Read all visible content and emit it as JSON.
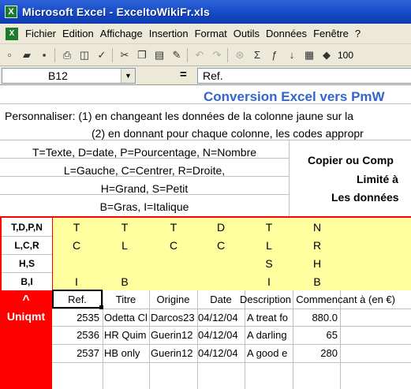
{
  "window": {
    "title": "Microsoft Excel - ExceltoWikiFr.xls",
    "app_icon": "X"
  },
  "menu": [
    "Fichier",
    "Edition",
    "Affichage",
    "Insertion",
    "Format",
    "Outils",
    "Données",
    "Fenêtre",
    "?"
  ],
  "toolbar": {
    "zoom": "100"
  },
  "formula_bar": {
    "name_box": "B12",
    "equals": "=",
    "value": "Ref."
  },
  "sheet": {
    "banner_title": "Conversion Excel vers PmW",
    "personaliser_line1": "Personnaliser: (1) en changeant les données de la colonne jaune sur la",
    "personaliser_line2": "(2) en donnant pour chaque colonne, les codes appropr",
    "codes": [
      "T=Texte, D=date, P=Pourcentage, N=Nombre",
      "L=Gauche, C=Centrer, R=Droite,",
      "H=Grand, S=Petit",
      "B=Gras, I=Italique"
    ],
    "copier": "Copier ou Comp",
    "limite": "Limité à",
    "les_donnees": "Les données",
    "format_labels": [
      "T,D,P,N",
      "L,C,R",
      "H,S",
      "B,I"
    ],
    "format_rows": [
      [
        "T",
        "T",
        "T",
        "D",
        "T",
        "N"
      ],
      [
        "C",
        "L",
        "C",
        "C",
        "L",
        "R"
      ],
      [
        "",
        "",
        "",
        "",
        "S",
        "H"
      ],
      [
        "I",
        "B",
        "",
        "",
        "I",
        "B"
      ]
    ],
    "red_caret": "^",
    "red_label": "Uniqmt",
    "headers": [
      "Ref.",
      "Titre",
      "Origine",
      "Date",
      "Description",
      "Commencant à (en €)"
    ],
    "rows": [
      [
        "2535",
        "Odetta Cl",
        "Darcos23",
        "04/12/04",
        "A treat fo",
        "880.0"
      ],
      [
        "2536",
        "HR Quim",
        "Guerin12",
        "04/12/04",
        "A darling",
        "65"
      ],
      [
        "2537",
        "HB only C",
        "Guerin12",
        "04/12/04",
        "A good e",
        "280"
      ]
    ]
  }
}
